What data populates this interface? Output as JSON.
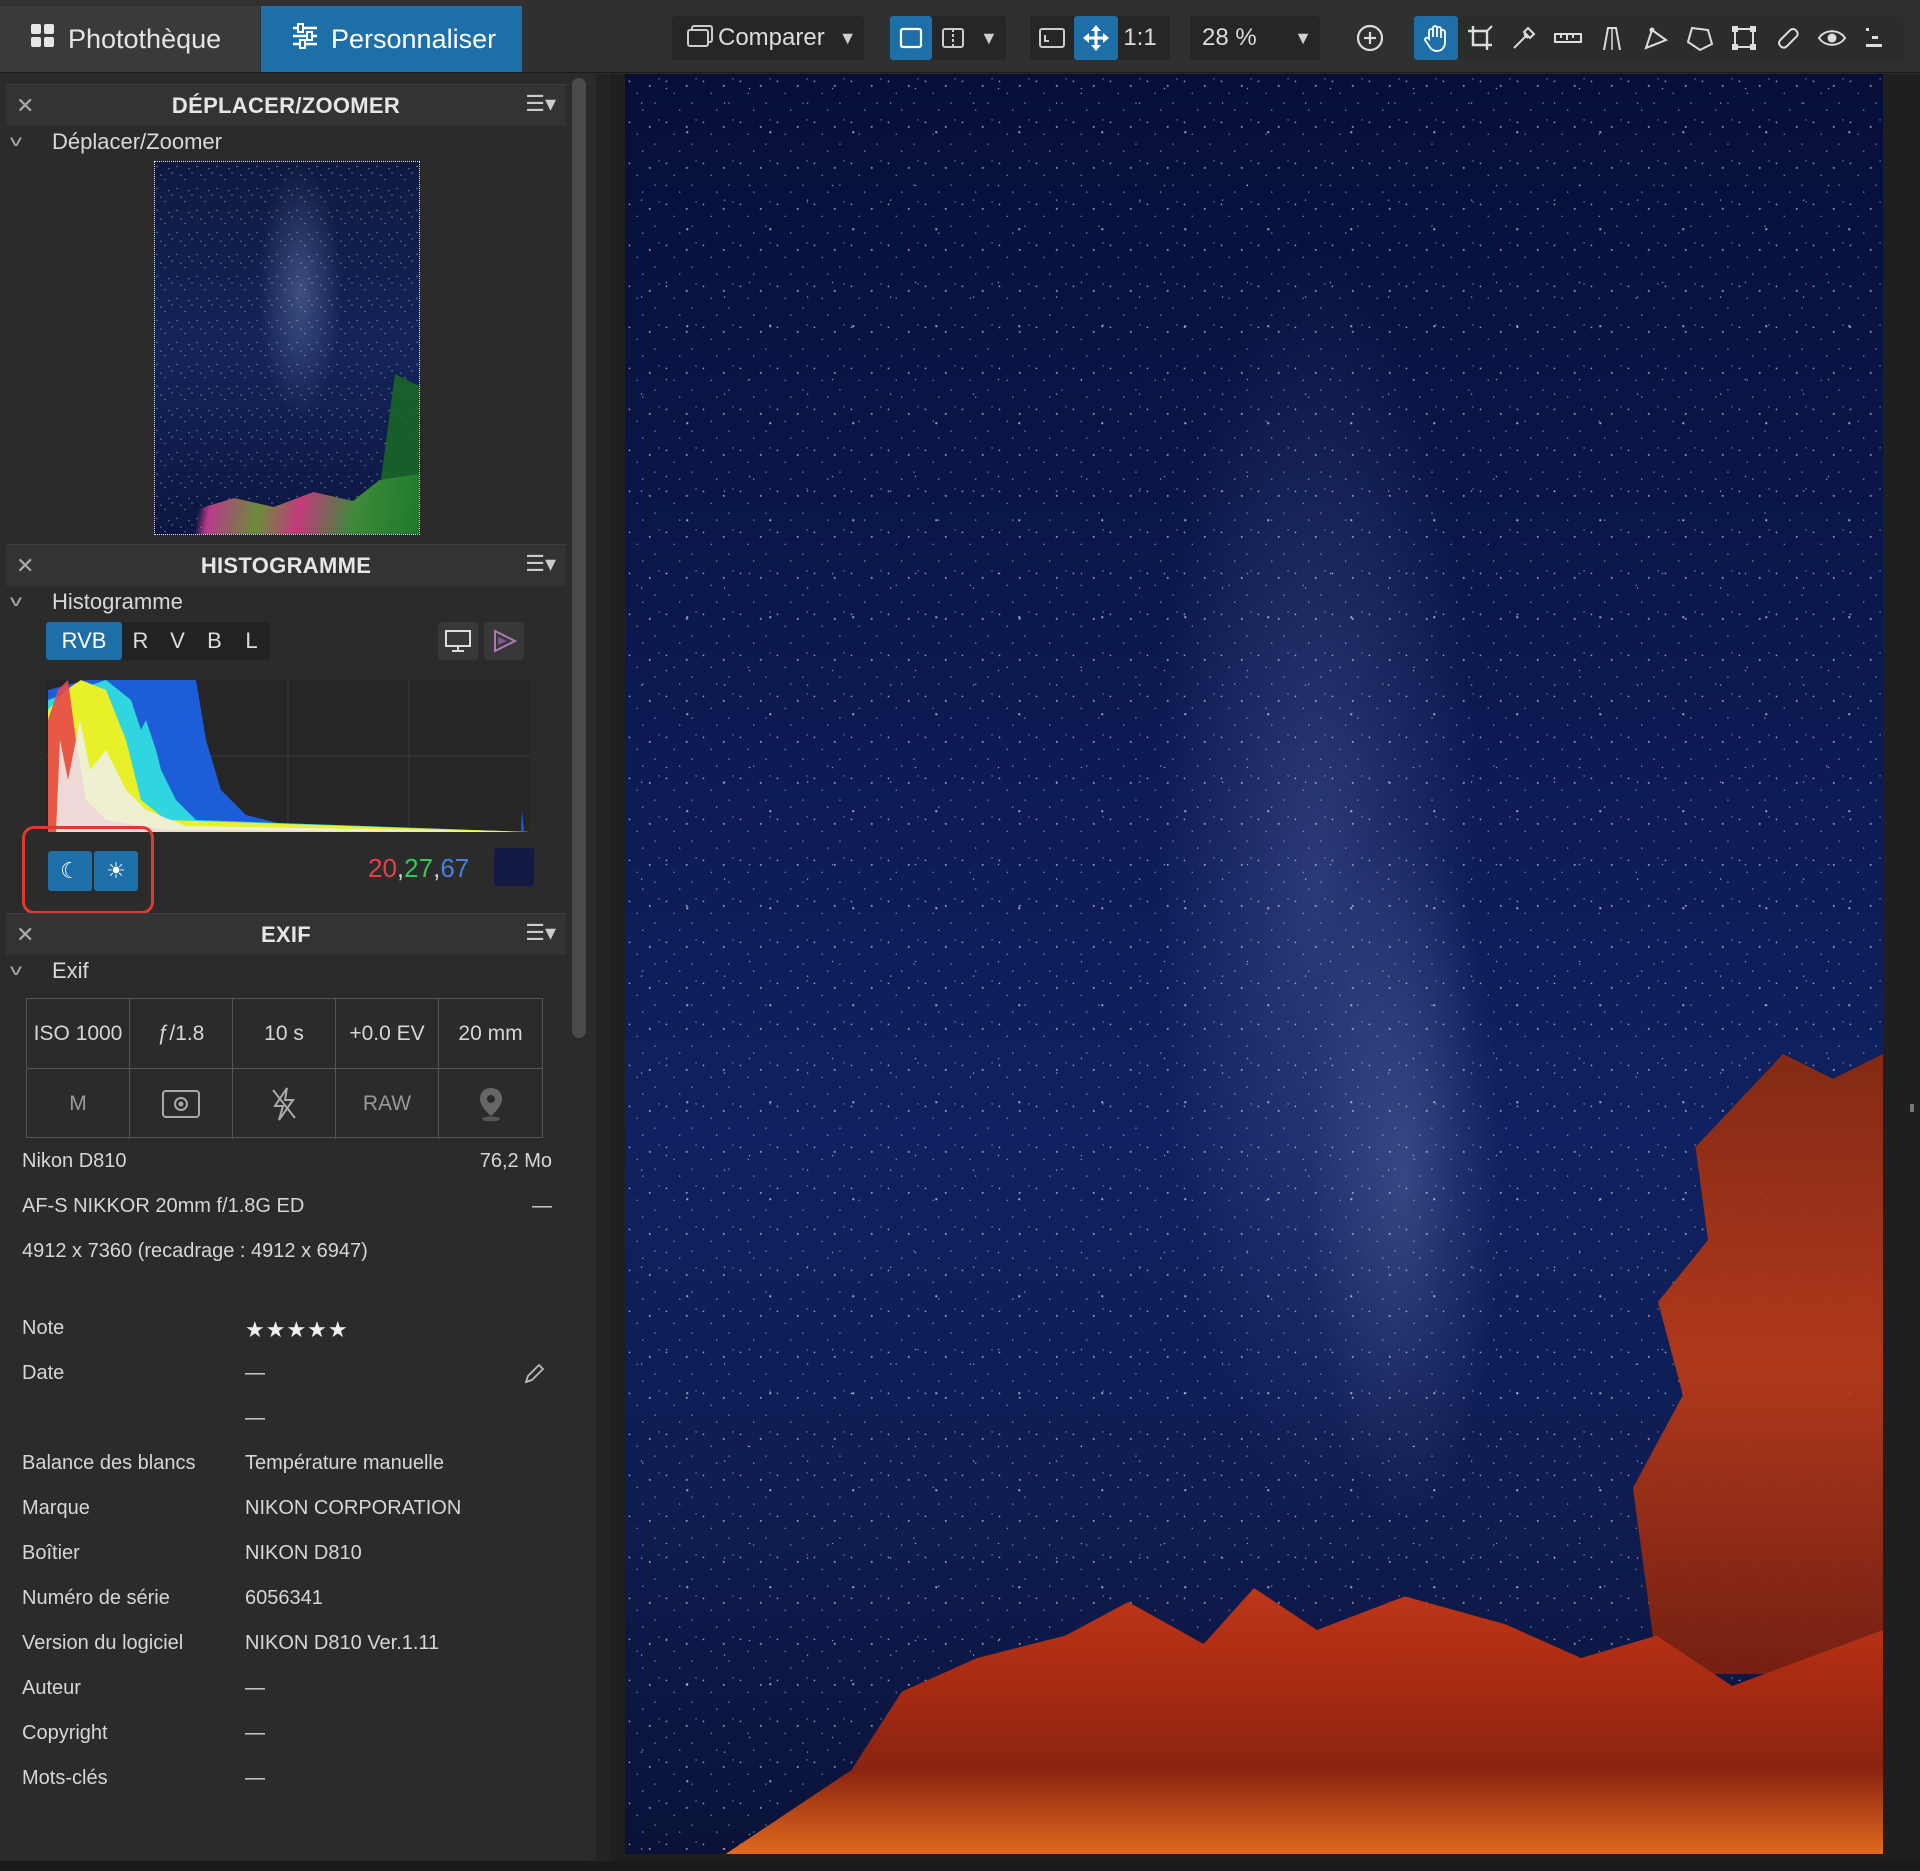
{
  "toolbar": {
    "tab_library": "Photothèque",
    "tab_customize": "Personnaliser",
    "compare_label": "Comparer",
    "one_to_one": "1:1",
    "zoom_value": "28 %"
  },
  "navigator": {
    "panel_title": "DÉPLACER/ZOOMER",
    "sub_title": "Déplacer/Zoomer"
  },
  "histogram": {
    "panel_title": "HISTOGRAMME",
    "sub_title": "Histogramme",
    "channels": [
      "RVB",
      "R",
      "V",
      "B",
      "L"
    ],
    "active_channel": "RVB",
    "readout_r": "20",
    "readout_g": "27",
    "readout_b": "67",
    "sep": ", ",
    "swatch_color": "#141a43",
    "colors": {
      "r": "#e8404a",
      "g": "#38c85a",
      "b": "#4a7fe0"
    }
  },
  "exif": {
    "panel_title": "EXIF",
    "sub_title": "Exif",
    "grid_top": [
      "ISO 1000",
      "ƒ/1.8",
      "10 s",
      "+0.0 EV",
      "20 mm"
    ],
    "mode": "M",
    "format": "RAW",
    "camera": "Nikon D810",
    "file_size": "76,2 Mo",
    "lens": "AF-S NIKKOR 20mm f/1.8G ED",
    "lens_extra": "—",
    "dimensions": "4912 x 7360 (recadrage : 4912 x 6947)",
    "rows": [
      {
        "key": "Note",
        "value": "★★★★★"
      },
      {
        "key": "Date",
        "value": "—"
      },
      {
        "key": "",
        "value": "—"
      },
      {
        "key": "Balance des blancs",
        "value": "Température manuelle"
      },
      {
        "key": "Marque",
        "value": "NIKON CORPORATION"
      },
      {
        "key": "Boîtier",
        "value": "NIKON D810"
      },
      {
        "key": "Numéro de série",
        "value": "6056341"
      },
      {
        "key": "Version du logiciel",
        "value": "NIKON D810 Ver.1.11"
      },
      {
        "key": "Auteur",
        "value": "—"
      },
      {
        "key": "Copyright",
        "value": "—"
      },
      {
        "key": "Mots-clés",
        "value": "—"
      }
    ]
  },
  "icons": {
    "library": "grid-icon",
    "customize": "sliders-icon",
    "compare": "compare-icon",
    "panel_menu": "menu-icon",
    "panel_close": "close-icon",
    "collapse": "chevron-down-icon"
  }
}
